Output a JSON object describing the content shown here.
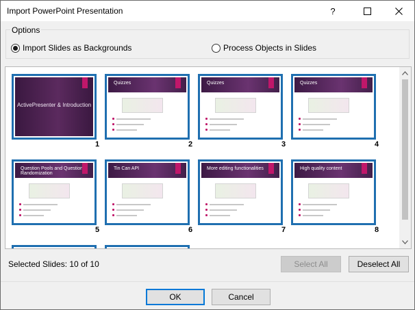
{
  "window": {
    "title": "Import PowerPoint Presentation"
  },
  "titlebar": {
    "help_glyph": "?",
    "maximize_icon": "maximize-icon",
    "close_icon": "close-icon"
  },
  "options": {
    "legend": "Options",
    "radio_backgrounds": "Import Slides as Backgrounds",
    "radio_objects": "Process Objects in Slides",
    "selected": "backgrounds"
  },
  "slides": [
    {
      "number": "1",
      "title": "ActivePresenter & Introduction",
      "style": "title-slide"
    },
    {
      "number": "2",
      "title": "Quizzes",
      "style": "content"
    },
    {
      "number": "3",
      "title": "Quizzes",
      "style": "content"
    },
    {
      "number": "4",
      "title": "Quizzes",
      "style": "content"
    },
    {
      "number": "5",
      "title": "Question Pools and Question Randomization",
      "style": "content"
    },
    {
      "number": "6",
      "title": "Tin Can API",
      "style": "content"
    },
    {
      "number": "7",
      "title": "More editing functionalities",
      "style": "content"
    },
    {
      "number": "8",
      "title": "High quality content",
      "style": "content"
    }
  ],
  "status": {
    "selected_slides": "Selected Slides: 10 of 10"
  },
  "buttons": {
    "select_all": "Select All",
    "deselect_all": "Deselect All",
    "ok": "OK",
    "cancel": "Cancel"
  },
  "colors": {
    "selection_border": "#1f6fb0",
    "slide_header": "#5b2a5e",
    "slide_accent": "#c0176a"
  }
}
